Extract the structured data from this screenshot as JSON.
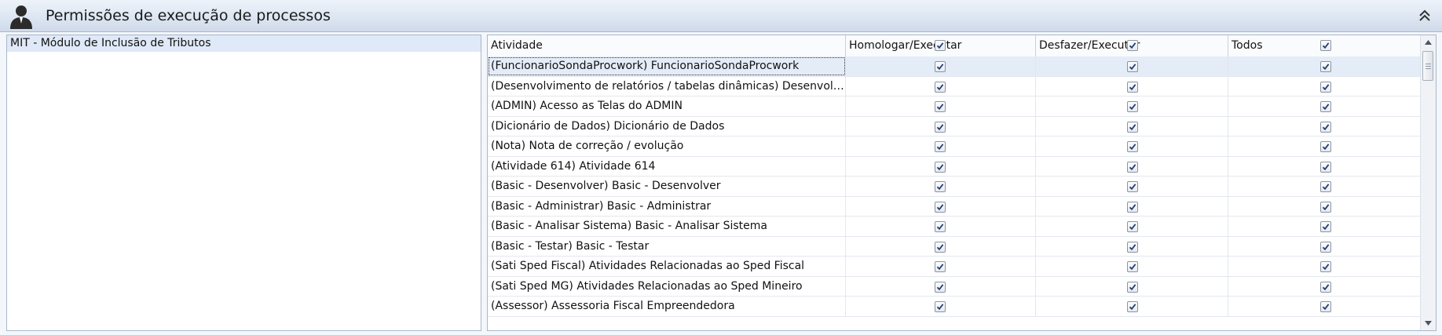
{
  "header": {
    "title": "Permissões de execução de processos",
    "icon": "user-icon",
    "collapse_icon": "double-chevron-up-icon"
  },
  "modules": [
    {
      "label": "MIT - Módulo de Inclusão de Tributos",
      "selected": true
    }
  ],
  "grid": {
    "columns": [
      {
        "label": "Atividade",
        "has_checkbox": false
      },
      {
        "label": "Homologar/Executar",
        "has_checkbox": true,
        "checked": true
      },
      {
        "label": "Desfazer/Executar",
        "has_checkbox": true,
        "checked": true
      },
      {
        "label": "Todos",
        "has_checkbox": true,
        "checked": true
      }
    ],
    "rows": [
      {
        "name": "(FuncionarioSondaProcwork) FuncionarioSondaProcwork",
        "homologar": true,
        "desfazer": true,
        "todos": true,
        "selected": true
      },
      {
        "name": "(Desenvolvimento de relatórios / tabelas dinâmicas) Desenvolvimento de relatórios / tabelas dinâmicas",
        "homologar": true,
        "desfazer": true,
        "todos": true
      },
      {
        "name": "(ADMIN) Acesso as Telas do ADMIN",
        "homologar": true,
        "desfazer": true,
        "todos": true
      },
      {
        "name": "(Dicionário de Dados) Dicionário de Dados",
        "homologar": true,
        "desfazer": true,
        "todos": true
      },
      {
        "name": "(Nota) Nota de correção / evolução",
        "homologar": true,
        "desfazer": true,
        "todos": true
      },
      {
        "name": "(Atividade 614) Atividade 614",
        "homologar": true,
        "desfazer": true,
        "todos": true
      },
      {
        "name": "(Basic - Desenvolver) Basic - Desenvolver",
        "homologar": true,
        "desfazer": true,
        "todos": true
      },
      {
        "name": "(Basic - Administrar) Basic - Administrar",
        "homologar": true,
        "desfazer": true,
        "todos": true
      },
      {
        "name": "(Basic - Analisar Sistema) Basic - Analisar Sistema",
        "homologar": true,
        "desfazer": true,
        "todos": true
      },
      {
        "name": "(Basic - Testar) Basic - Testar",
        "homologar": true,
        "desfazer": true,
        "todos": true
      },
      {
        "name": "(Sati Sped Fiscal) Atividades Relacionadas ao Sped Fiscal",
        "homologar": true,
        "desfazer": true,
        "todos": true
      },
      {
        "name": "(Sati Sped MG) Atividades Relacionadas ao Sped Mineiro",
        "homologar": true,
        "desfazer": true,
        "todos": true
      },
      {
        "name": "(Assessor) Assessoria Fiscal Empreendedora",
        "homologar": true,
        "desfazer": true,
        "todos": true
      }
    ]
  },
  "colors": {
    "header_bg": "#dde6f2",
    "selected_row": "#e4ecf8",
    "border": "#a9b7c9"
  }
}
